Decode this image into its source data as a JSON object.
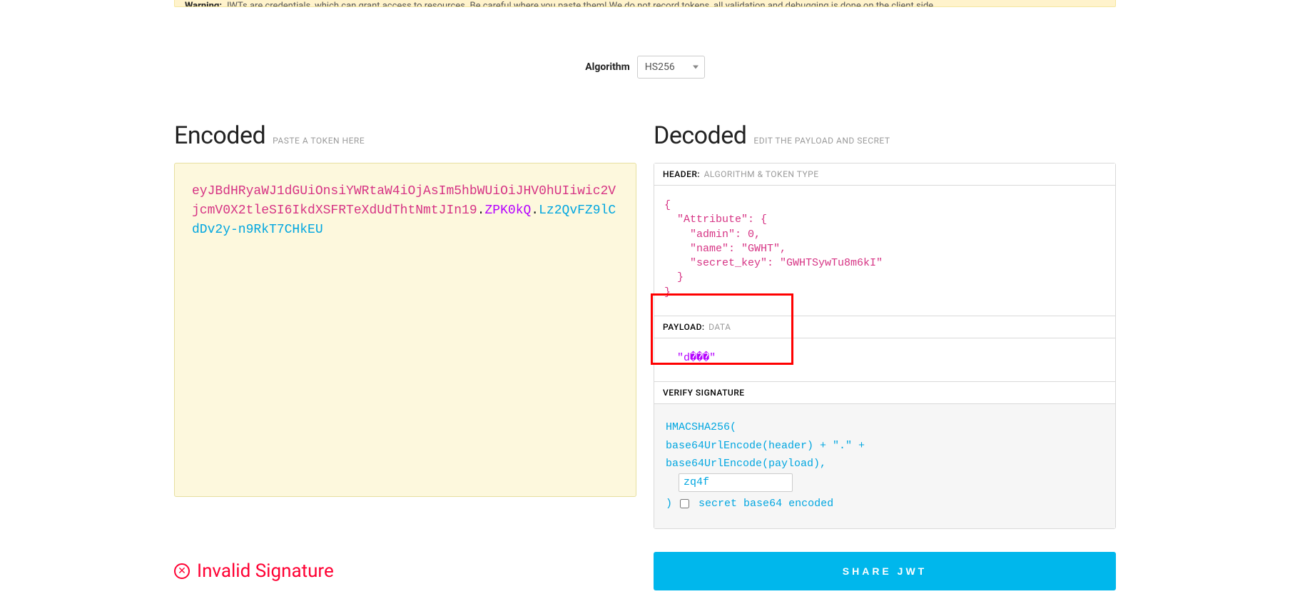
{
  "warning": {
    "label": "Warning:",
    "text": "JWTs are credentials, which can grant access to resources. Be careful where you paste them! We do not record tokens, all validation and debugging is done on the client side."
  },
  "algorithm": {
    "label": "Algorithm",
    "selected": "HS256"
  },
  "encoded": {
    "title": "Encoded",
    "hint": "PASTE A TOKEN HERE",
    "token_header": "eyJBdHRyaWJ1dGUiOnsiYWRtaW4iOjAsIm5hbWUiOiJHV0hUIiwic2VjcmV0X2tleSI6IkdXSFRTeXdUdThtNmtJIn19",
    "token_payload": "ZPK0kQ",
    "token_sig": "Lz2QvFZ9lCdDv2y-n9RkT7CHkEU"
  },
  "decoded": {
    "title": "Decoded",
    "hint": "EDIT THE PAYLOAD AND SECRET",
    "header_section": {
      "label": "HEADER:",
      "sublabel": "ALGORITHM & TOKEN TYPE",
      "json": "{\n  \"Attribute\": {\n    \"admin\": 0,\n    \"name\": \"GWHT\",\n    \"secret_key\": \"GWHTSywTu8m6kI\"\n  }\n}"
    },
    "payload_section": {
      "label": "PAYLOAD:",
      "sublabel": "DATA",
      "json": "  \"d���\""
    },
    "signature_section": {
      "label": "VERIFY SIGNATURE",
      "line1": "HMACSHA256(",
      "line2": "  base64UrlEncode(header) + \".\" +",
      "line3": "  base64UrlEncode(payload),",
      "secret_value": "zq4f",
      "close_paren": ")",
      "checkbox_label": "secret base64 encoded"
    }
  },
  "status": {
    "text": "Invalid Signature"
  },
  "share": {
    "label": "SHARE JWT"
  }
}
